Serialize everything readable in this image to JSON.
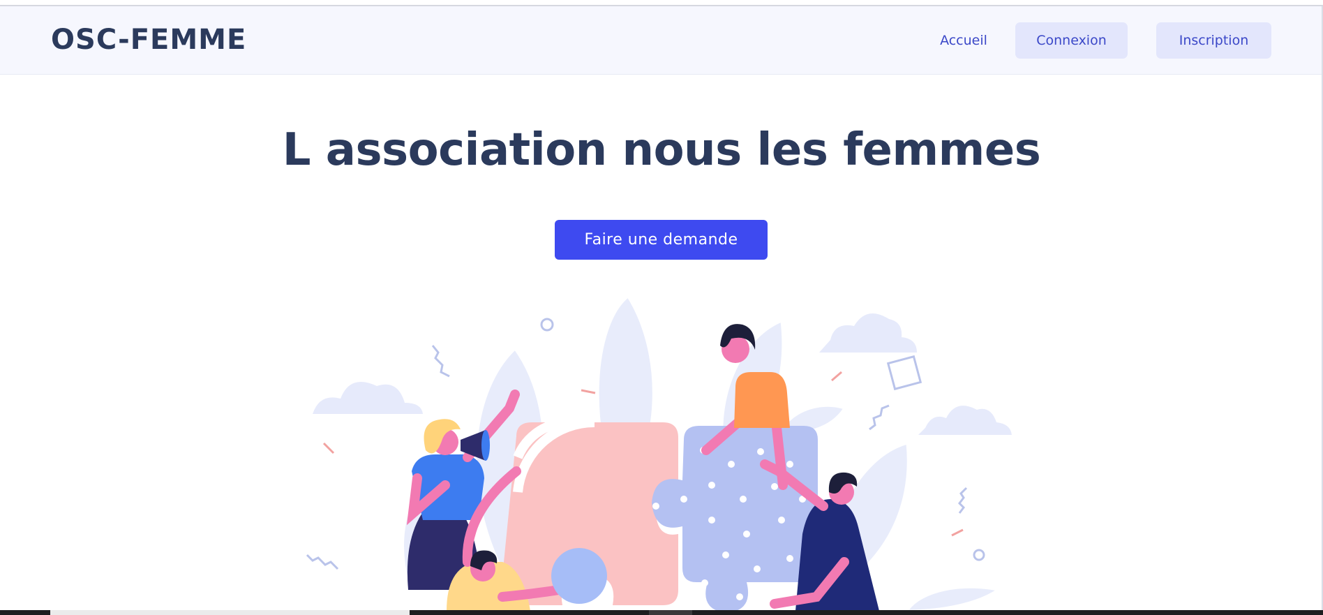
{
  "navbar": {
    "brand": "OSC-FEMME",
    "links": [
      {
        "label": "Accueil"
      },
      {
        "label": "Connexion"
      },
      {
        "label": "Inscription"
      }
    ]
  },
  "hero": {
    "title": "L association nous les femmes",
    "cta_label": "Faire une demande"
  },
  "colors": {
    "primary": "#3e4af0",
    "heading": "#2b3a5c",
    "nav_background": "#f6f7fe",
    "button_soft": "#e3e6fc"
  },
  "illustration": {
    "subject": "team-puzzle-illustration",
    "icons": [
      "megaphone-icon",
      "puzzle-piece-icon",
      "cloud-icon",
      "leaf-icon"
    ]
  }
}
